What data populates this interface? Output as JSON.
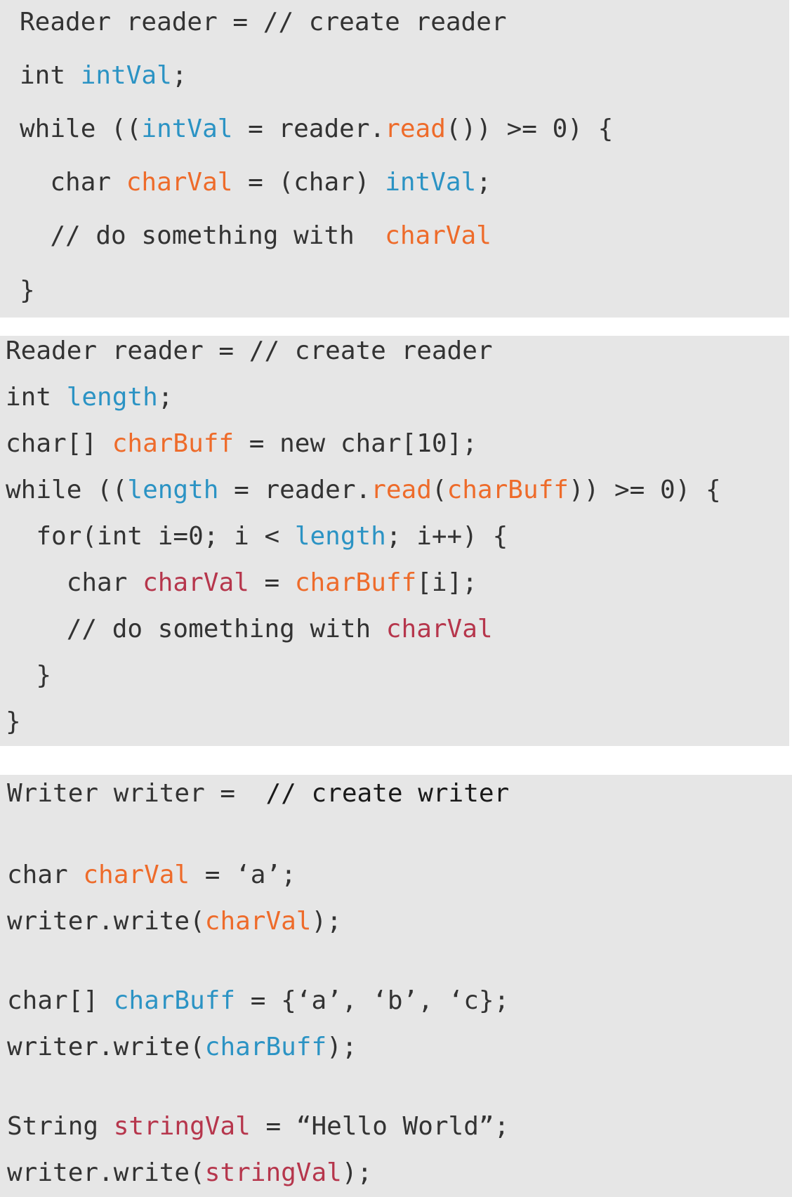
{
  "colors": {
    "background": "#ffffff",
    "panel": "#e6e6e6",
    "default_text": "#333333",
    "identifier_blue": "#2b93c4",
    "identifier_orange": "#ee6b2a",
    "identifier_crimson": "#b6364c",
    "comment_black": "#1a1a1a"
  },
  "panels": [
    {
      "lines": [
        [
          {
            "t": "Reader reader = // create reader",
            "c": "default"
          }
        ],
        [
          {
            "t": "int ",
            "c": "default"
          },
          {
            "t": "intVal",
            "c": "blue"
          },
          {
            "t": ";",
            "c": "default"
          }
        ],
        [
          {
            "t": "while ((",
            "c": "default"
          },
          {
            "t": "intVal",
            "c": "blue"
          },
          {
            "t": " = reader.",
            "c": "default"
          },
          {
            "t": "read",
            "c": "orange"
          },
          {
            "t": "()) >= 0) {",
            "c": "default"
          }
        ],
        [
          {
            "t": "  char ",
            "c": "default"
          },
          {
            "t": "charVal",
            "c": "orange"
          },
          {
            "t": " = (char) ",
            "c": "default"
          },
          {
            "t": "intVal",
            "c": "blue"
          },
          {
            "t": ";",
            "c": "default"
          }
        ],
        [
          {
            "t": "  // do something with  ",
            "c": "default"
          },
          {
            "t": "charVal",
            "c": "orange"
          }
        ],
        [
          {
            "t": "}",
            "c": "default"
          }
        ]
      ]
    },
    {
      "lines": [
        [
          {
            "t": "Reader reader = // create reader",
            "c": "default"
          }
        ],
        [
          {
            "t": "int ",
            "c": "default"
          },
          {
            "t": "length",
            "c": "blue"
          },
          {
            "t": ";",
            "c": "default"
          }
        ],
        [
          {
            "t": "char[] ",
            "c": "default"
          },
          {
            "t": "charBuff",
            "c": "orange"
          },
          {
            "t": " = new char[10];",
            "c": "default"
          }
        ],
        [
          {
            "t": "while ((",
            "c": "default"
          },
          {
            "t": "length",
            "c": "blue"
          },
          {
            "t": " = reader.",
            "c": "default"
          },
          {
            "t": "read",
            "c": "orange"
          },
          {
            "t": "(",
            "c": "default"
          },
          {
            "t": "charBuff",
            "c": "orange"
          },
          {
            "t": ")) >= 0) {",
            "c": "default"
          }
        ],
        [
          {
            "t": "  for(int i=0; i < ",
            "c": "default"
          },
          {
            "t": "length",
            "c": "blue"
          },
          {
            "t": "; i++) {",
            "c": "default"
          }
        ],
        [
          {
            "t": "    char ",
            "c": "default"
          },
          {
            "t": "charVal",
            "c": "crimson"
          },
          {
            "t": " = ",
            "c": "default"
          },
          {
            "t": "charBuff",
            "c": "orange"
          },
          {
            "t": "[i];",
            "c": "default"
          }
        ],
        [
          {
            "t": "    // do something with ",
            "c": "default"
          },
          {
            "t": "charVal",
            "c": "crimson"
          }
        ],
        [
          {
            "t": "  }",
            "c": "default"
          }
        ],
        [
          {
            "t": "}",
            "c": "default"
          }
        ]
      ]
    },
    {
      "lines": [
        [
          {
            "t": "Writer writer =  ",
            "c": "default"
          },
          {
            "t": "// create writer",
            "c": "black"
          }
        ],
        [
          {
            "t": "char ",
            "c": "default"
          },
          {
            "t": "charVal",
            "c": "orange"
          },
          {
            "t": " = ‘a’;",
            "c": "default"
          }
        ],
        [
          {
            "t": "writer.write(",
            "c": "default"
          },
          {
            "t": "charVal",
            "c": "orange"
          },
          {
            "t": ");",
            "c": "default"
          }
        ],
        [
          {
            "t": "char[] ",
            "c": "default"
          },
          {
            "t": "charBuff",
            "c": "blue"
          },
          {
            "t": " = {‘a’, ‘b’, ‘c};",
            "c": "default"
          }
        ],
        [
          {
            "t": "writer.write(",
            "c": "default"
          },
          {
            "t": "charBuff",
            "c": "blue"
          },
          {
            "t": ");",
            "c": "default"
          }
        ],
        [
          {
            "t": "String ",
            "c": "default"
          },
          {
            "t": "stringVal",
            "c": "crimson"
          },
          {
            "t": " = “Hello World”;",
            "c": "default"
          }
        ],
        [
          {
            "t": "writer.write(",
            "c": "default"
          },
          {
            "t": "stringVal",
            "c": "crimson"
          },
          {
            "t": ");",
            "c": "default"
          }
        ]
      ]
    }
  ]
}
